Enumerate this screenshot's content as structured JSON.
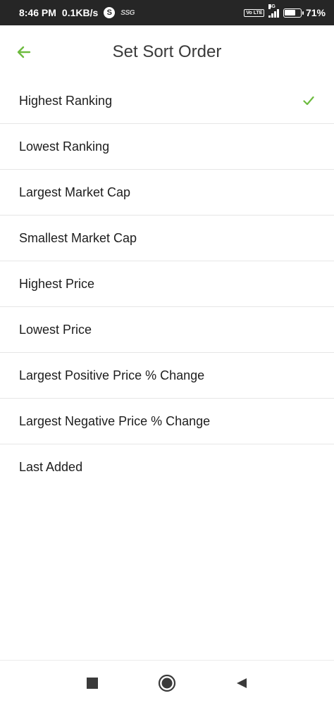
{
  "status_bar": {
    "time": "8:46 PM",
    "speed": "0.1KB/s",
    "app_badge": "S",
    "carrier_tag": "SSG",
    "volte": "Vo LTE",
    "network": "4G",
    "battery": "71%",
    "battery_level": 0.71
  },
  "header": {
    "title": "Set Sort Order",
    "back_icon": "arrow-left-icon"
  },
  "sort_options": [
    {
      "label": "Highest Ranking",
      "selected": true
    },
    {
      "label": "Lowest Ranking",
      "selected": false
    },
    {
      "label": "Largest Market Cap",
      "selected": false
    },
    {
      "label": "Smallest Market Cap",
      "selected": false
    },
    {
      "label": "Highest Price",
      "selected": false
    },
    {
      "label": "Lowest Price",
      "selected": false
    },
    {
      "label": "Largest Positive Price % Change",
      "selected": false
    },
    {
      "label": "Largest Negative Price % Change",
      "selected": false
    },
    {
      "label": "Last Added",
      "selected": false
    }
  ],
  "colors": {
    "accent": "#6dbb3f",
    "status_bar_bg": "#262626",
    "text": "#1d1d1d",
    "divider": "#e6e6e6"
  },
  "nav": {
    "recents_icon": "square-icon",
    "home_icon": "circle-icon",
    "back_icon": "triangle-back-icon"
  }
}
